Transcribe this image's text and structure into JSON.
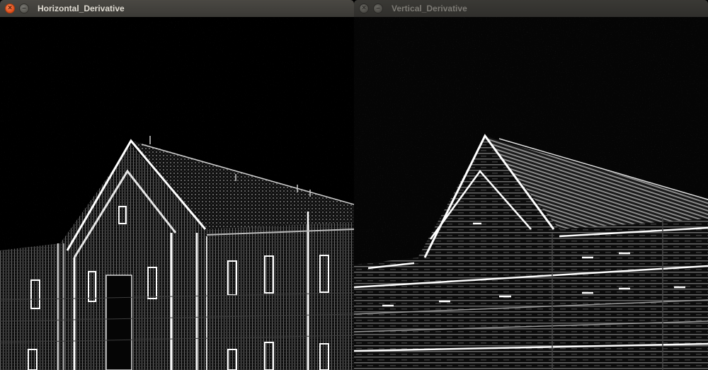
{
  "windows": [
    {
      "title": "Horizontal_Derivative",
      "state": "active",
      "buttons": {
        "close": "close-icon",
        "minimize": "minimize-icon"
      }
    },
    {
      "title": "Vertical_Derivative",
      "state": "inactive",
      "buttons": {
        "close": "close-icon",
        "minimize": "minimize-icon"
      }
    }
  ],
  "glyphs": {
    "close": "×",
    "minimize": "–"
  },
  "colors": {
    "titlebar_active": "#3b3a36",
    "titlebar_inactive": "#302f2c",
    "close_active": "#df4a16",
    "title_active_text": "#dfdbd2",
    "title_inactive_text": "#7c7a74",
    "image_background": "#000000",
    "edge_highlight": "#ffffff"
  }
}
